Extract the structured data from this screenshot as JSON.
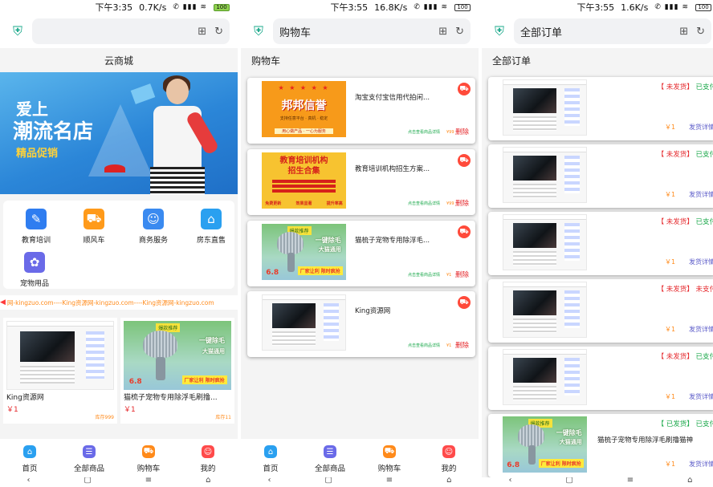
{
  "panels": [
    {
      "status": {
        "time": "下午3:35",
        "speed": "0.7K/s",
        "battery": "100"
      },
      "browser": {
        "url": ""
      },
      "appbar_title": "云商城",
      "banner": {
        "line1": "爱上",
        "line2": "潮流名店",
        "line3": "精品促销"
      },
      "categories": [
        {
          "label": "教育培训",
          "icon": "education-icon",
          "color": "#2f7df0"
        },
        {
          "label": "顺风车",
          "icon": "car-icon",
          "color": "#ff9a1a"
        },
        {
          "label": "商务服务",
          "icon": "business-person-icon",
          "color": "#3a8af0"
        },
        {
          "label": "房东直售",
          "icon": "house-icon",
          "color": "#2aa0f0"
        },
        {
          "label": "宠物用品",
          "icon": "pet-paw-icon",
          "color": "#6a6ae8"
        }
      ],
      "marquee": "网-kingzuo.com----King资源网-kingzuo.com----King资源网-kingzuo.com",
      "products": [
        {
          "name": "King资源网",
          "price": "￥1",
          "stock": "库存999"
        },
        {
          "name": "猫梳子宠物专用除浮毛刷撸...",
          "price": "￥1",
          "stock": "库存11"
        }
      ]
    },
    {
      "status": {
        "time": "下午3:55",
        "speed": "16.8K/s",
        "battery": "100"
      },
      "browser": {
        "url": "购物车"
      },
      "appbar_title": "购物车",
      "cart": {
        "detail_label": "点击查看商品详情",
        "delete_label": "删除",
        "items": [
          {
            "title": "淘宝支付宝信用代拍闲...",
            "price": "¥99"
          },
          {
            "title": "教育培训机构招生方案...",
            "price": "¥99"
          },
          {
            "title": "猫梳子宠物专用除浮毛...",
            "price": "¥1"
          },
          {
            "title": "King资源网",
            "price": "¥1"
          }
        ]
      }
    },
    {
      "status": {
        "time": "下午3:55",
        "speed": "1.6K/s",
        "battery": "100"
      },
      "browser": {
        "url": "全部订单"
      },
      "appbar_title": "全部订单",
      "orders": {
        "detail_label": "发货详情",
        "items": [
          {
            "ship": "【 未发货】",
            "pay": "已支付",
            "pay_color": "#1aa84a",
            "price": "￥1"
          },
          {
            "ship": "【 未发货】",
            "pay": "已支付",
            "pay_color": "#1aa84a",
            "price": "￥1"
          },
          {
            "ship": "【 未发货】",
            "pay": "已支付",
            "pay_color": "#1aa84a",
            "price": "￥1"
          },
          {
            "ship": "【 未发货】",
            "pay": "未支付",
            "pay_color": "#e5262a",
            "price": "￥1"
          },
          {
            "ship": "【 未发货】",
            "pay": "已支付",
            "pay_color": "#1aa84a",
            "price": "￥1"
          },
          {
            "ship": "【 已发货】",
            "pay": "已支付",
            "pay_color": "#1aa84a",
            "price": "￥1",
            "title": "猫梳子宠物专用除浮毛刷撸猫神"
          }
        ]
      }
    }
  ],
  "thumbs": {
    "bang": {
      "stars": "★ ★ ★ ★ ★",
      "big": "邦邦信誉",
      "small": "支持任意平台 · 真机 · 稳定",
      "bar": "用心做产品 · 一心为服务"
    },
    "edu": {
      "t1": "教育培训机构",
      "t2": "招生合集",
      "foot": [
        "免费更新",
        "效果显著",
        "提升率高"
      ]
    },
    "comb": {
      "tag": "爆款推荐",
      "t1": "一键除毛",
      "t2": "大猫通用",
      "num": "6.8",
      "banner": "厂家让利 限时疯抢"
    }
  },
  "tabbar": [
    {
      "label": "首页",
      "icon": "home-icon",
      "color": "#2aa0f0"
    },
    {
      "label": "全部商品",
      "icon": "all-products-icon",
      "color": "#6a6ae8"
    },
    {
      "label": "购物车",
      "icon": "cart-icon",
      "color": "#ff8a1a"
    },
    {
      "label": "我的",
      "icon": "profile-icon",
      "color": "#ff4a4a"
    }
  ],
  "colors": {
    "accent": "#1aa88a",
    "price": "#e5262a",
    "paid": "#1aa84a",
    "detail": "#5a5ac8"
  }
}
